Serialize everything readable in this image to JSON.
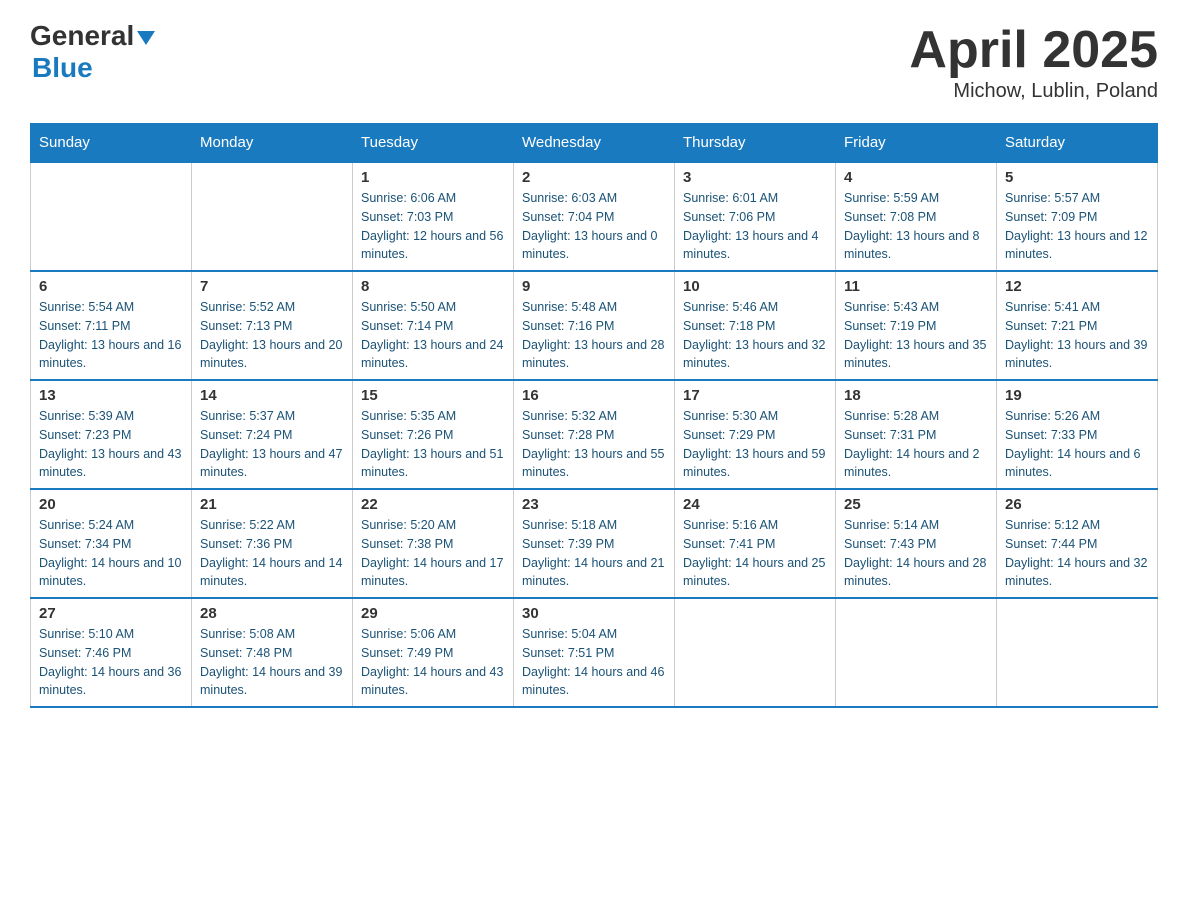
{
  "header": {
    "logo_general": "General",
    "logo_blue": "Blue",
    "title": "April 2025",
    "subtitle": "Michow, Lublin, Poland"
  },
  "days_of_week": [
    "Sunday",
    "Monday",
    "Tuesday",
    "Wednesday",
    "Thursday",
    "Friday",
    "Saturday"
  ],
  "weeks": [
    [
      {
        "day": "",
        "sunrise": "",
        "sunset": "",
        "daylight": ""
      },
      {
        "day": "",
        "sunrise": "",
        "sunset": "",
        "daylight": ""
      },
      {
        "day": "1",
        "sunrise": "Sunrise: 6:06 AM",
        "sunset": "Sunset: 7:03 PM",
        "daylight": "Daylight: 12 hours and 56 minutes."
      },
      {
        "day": "2",
        "sunrise": "Sunrise: 6:03 AM",
        "sunset": "Sunset: 7:04 PM",
        "daylight": "Daylight: 13 hours and 0 minutes."
      },
      {
        "day": "3",
        "sunrise": "Sunrise: 6:01 AM",
        "sunset": "Sunset: 7:06 PM",
        "daylight": "Daylight: 13 hours and 4 minutes."
      },
      {
        "day": "4",
        "sunrise": "Sunrise: 5:59 AM",
        "sunset": "Sunset: 7:08 PM",
        "daylight": "Daylight: 13 hours and 8 minutes."
      },
      {
        "day": "5",
        "sunrise": "Sunrise: 5:57 AM",
        "sunset": "Sunset: 7:09 PM",
        "daylight": "Daylight: 13 hours and 12 minutes."
      }
    ],
    [
      {
        "day": "6",
        "sunrise": "Sunrise: 5:54 AM",
        "sunset": "Sunset: 7:11 PM",
        "daylight": "Daylight: 13 hours and 16 minutes."
      },
      {
        "day": "7",
        "sunrise": "Sunrise: 5:52 AM",
        "sunset": "Sunset: 7:13 PM",
        "daylight": "Daylight: 13 hours and 20 minutes."
      },
      {
        "day": "8",
        "sunrise": "Sunrise: 5:50 AM",
        "sunset": "Sunset: 7:14 PM",
        "daylight": "Daylight: 13 hours and 24 minutes."
      },
      {
        "day": "9",
        "sunrise": "Sunrise: 5:48 AM",
        "sunset": "Sunset: 7:16 PM",
        "daylight": "Daylight: 13 hours and 28 minutes."
      },
      {
        "day": "10",
        "sunrise": "Sunrise: 5:46 AM",
        "sunset": "Sunset: 7:18 PM",
        "daylight": "Daylight: 13 hours and 32 minutes."
      },
      {
        "day": "11",
        "sunrise": "Sunrise: 5:43 AM",
        "sunset": "Sunset: 7:19 PM",
        "daylight": "Daylight: 13 hours and 35 minutes."
      },
      {
        "day": "12",
        "sunrise": "Sunrise: 5:41 AM",
        "sunset": "Sunset: 7:21 PM",
        "daylight": "Daylight: 13 hours and 39 minutes."
      }
    ],
    [
      {
        "day": "13",
        "sunrise": "Sunrise: 5:39 AM",
        "sunset": "Sunset: 7:23 PM",
        "daylight": "Daylight: 13 hours and 43 minutes."
      },
      {
        "day": "14",
        "sunrise": "Sunrise: 5:37 AM",
        "sunset": "Sunset: 7:24 PM",
        "daylight": "Daylight: 13 hours and 47 minutes."
      },
      {
        "day": "15",
        "sunrise": "Sunrise: 5:35 AM",
        "sunset": "Sunset: 7:26 PM",
        "daylight": "Daylight: 13 hours and 51 minutes."
      },
      {
        "day": "16",
        "sunrise": "Sunrise: 5:32 AM",
        "sunset": "Sunset: 7:28 PM",
        "daylight": "Daylight: 13 hours and 55 minutes."
      },
      {
        "day": "17",
        "sunrise": "Sunrise: 5:30 AM",
        "sunset": "Sunset: 7:29 PM",
        "daylight": "Daylight: 13 hours and 59 minutes."
      },
      {
        "day": "18",
        "sunrise": "Sunrise: 5:28 AM",
        "sunset": "Sunset: 7:31 PM",
        "daylight": "Daylight: 14 hours and 2 minutes."
      },
      {
        "day": "19",
        "sunrise": "Sunrise: 5:26 AM",
        "sunset": "Sunset: 7:33 PM",
        "daylight": "Daylight: 14 hours and 6 minutes."
      }
    ],
    [
      {
        "day": "20",
        "sunrise": "Sunrise: 5:24 AM",
        "sunset": "Sunset: 7:34 PM",
        "daylight": "Daylight: 14 hours and 10 minutes."
      },
      {
        "day": "21",
        "sunrise": "Sunrise: 5:22 AM",
        "sunset": "Sunset: 7:36 PM",
        "daylight": "Daylight: 14 hours and 14 minutes."
      },
      {
        "day": "22",
        "sunrise": "Sunrise: 5:20 AM",
        "sunset": "Sunset: 7:38 PM",
        "daylight": "Daylight: 14 hours and 17 minutes."
      },
      {
        "day": "23",
        "sunrise": "Sunrise: 5:18 AM",
        "sunset": "Sunset: 7:39 PM",
        "daylight": "Daylight: 14 hours and 21 minutes."
      },
      {
        "day": "24",
        "sunrise": "Sunrise: 5:16 AM",
        "sunset": "Sunset: 7:41 PM",
        "daylight": "Daylight: 14 hours and 25 minutes."
      },
      {
        "day": "25",
        "sunrise": "Sunrise: 5:14 AM",
        "sunset": "Sunset: 7:43 PM",
        "daylight": "Daylight: 14 hours and 28 minutes."
      },
      {
        "day": "26",
        "sunrise": "Sunrise: 5:12 AM",
        "sunset": "Sunset: 7:44 PM",
        "daylight": "Daylight: 14 hours and 32 minutes."
      }
    ],
    [
      {
        "day": "27",
        "sunrise": "Sunrise: 5:10 AM",
        "sunset": "Sunset: 7:46 PM",
        "daylight": "Daylight: 14 hours and 36 minutes."
      },
      {
        "day": "28",
        "sunrise": "Sunrise: 5:08 AM",
        "sunset": "Sunset: 7:48 PM",
        "daylight": "Daylight: 14 hours and 39 minutes."
      },
      {
        "day": "29",
        "sunrise": "Sunrise: 5:06 AM",
        "sunset": "Sunset: 7:49 PM",
        "daylight": "Daylight: 14 hours and 43 minutes."
      },
      {
        "day": "30",
        "sunrise": "Sunrise: 5:04 AM",
        "sunset": "Sunset: 7:51 PM",
        "daylight": "Daylight: 14 hours and 46 minutes."
      },
      {
        "day": "",
        "sunrise": "",
        "sunset": "",
        "daylight": ""
      },
      {
        "day": "",
        "sunrise": "",
        "sunset": "",
        "daylight": ""
      },
      {
        "day": "",
        "sunrise": "",
        "sunset": "",
        "daylight": ""
      }
    ]
  ]
}
